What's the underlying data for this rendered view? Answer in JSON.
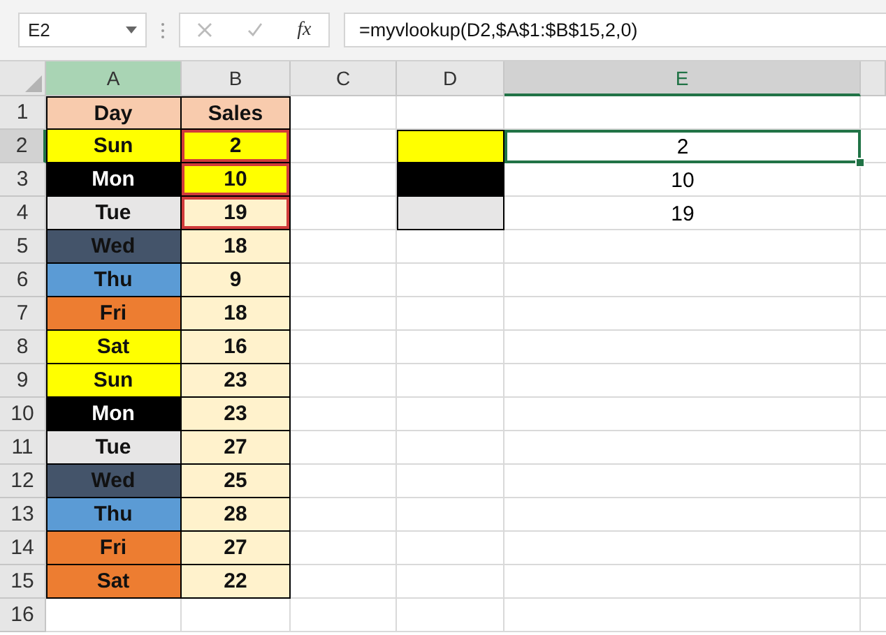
{
  "formula_bar": {
    "name_box": "E2",
    "function_label": "fx",
    "formula": "=myvlookup(D2,$A$1:$B$15,2,0)"
  },
  "columns": [
    {
      "label": "A",
      "selected": false,
      "highlighted": true
    },
    {
      "label": "B",
      "selected": false,
      "highlighted": false
    },
    {
      "label": "C",
      "selected": false,
      "highlighted": false
    },
    {
      "label": "D",
      "selected": false,
      "highlighted": false
    },
    {
      "label": "E",
      "selected": true,
      "highlighted": false
    }
  ],
  "rows": [
    {
      "number": "1",
      "selected": false,
      "a": {
        "text": "Day",
        "color": "#f8cbad"
      },
      "b": {
        "text": "Sales",
        "color": "#f8cbad",
        "outlined": false
      }
    },
    {
      "number": "2",
      "selected": true,
      "a": {
        "text": "Sun",
        "color": "#ffff00"
      },
      "b": {
        "text": "2",
        "color": "#ffff00",
        "outlined": true
      },
      "d": {
        "color": "#ffff00"
      },
      "e": {
        "text": "2",
        "selected": true
      }
    },
    {
      "number": "3",
      "selected": false,
      "a": {
        "text": "Mon",
        "color": "#000000"
      },
      "b": {
        "text": "10",
        "color": "#ffff00",
        "outlined": true
      },
      "d": {
        "color": "#000000"
      },
      "e": {
        "text": "10",
        "selected": false
      }
    },
    {
      "number": "4",
      "selected": false,
      "a": {
        "text": "Tue",
        "color": "#e7e6e6"
      },
      "b": {
        "text": "19",
        "color": "#fff2cc",
        "outlined": true
      },
      "d": {
        "color": "#e7e6e6"
      },
      "e": {
        "text": "19",
        "selected": false
      }
    },
    {
      "number": "5",
      "selected": false,
      "a": {
        "text": "Wed",
        "color": "#44546a"
      },
      "b": {
        "text": "18",
        "color": "#fff2cc",
        "outlined": false
      }
    },
    {
      "number": "6",
      "selected": false,
      "a": {
        "text": "Thu",
        "color": "#5b9bd5"
      },
      "b": {
        "text": "9",
        "color": "#fff2cc",
        "outlined": false
      }
    },
    {
      "number": "7",
      "selected": false,
      "a": {
        "text": "Fri",
        "color": "#ed7d31"
      },
      "b": {
        "text": "18",
        "color": "#fff2cc",
        "outlined": false
      }
    },
    {
      "number": "8",
      "selected": false,
      "a": {
        "text": "Sat",
        "color": "#ffff00"
      },
      "b": {
        "text": "16",
        "color": "#fff2cc",
        "outlined": false
      }
    },
    {
      "number": "9",
      "selected": false,
      "a": {
        "text": "Sun",
        "color": "#ffff00"
      },
      "b": {
        "text": "23",
        "color": "#fff2cc",
        "outlined": false
      }
    },
    {
      "number": "10",
      "selected": false,
      "a": {
        "text": "Mon",
        "color": "#000000"
      },
      "b": {
        "text": "23",
        "color": "#fff2cc",
        "outlined": false
      }
    },
    {
      "number": "11",
      "selected": false,
      "a": {
        "text": "Tue",
        "color": "#e7e6e6"
      },
      "b": {
        "text": "27",
        "color": "#fff2cc",
        "outlined": false
      }
    },
    {
      "number": "12",
      "selected": false,
      "a": {
        "text": "Wed",
        "color": "#44546a"
      },
      "b": {
        "text": "25",
        "color": "#fff2cc",
        "outlined": false
      }
    },
    {
      "number": "13",
      "selected": false,
      "a": {
        "text": "Thu",
        "color": "#5b9bd5"
      },
      "b": {
        "text": "28",
        "color": "#fff2cc",
        "outlined": false
      }
    },
    {
      "number": "14",
      "selected": false,
      "a": {
        "text": "Fri",
        "color": "#ed7d31"
      },
      "b": {
        "text": "27",
        "color": "#fff2cc",
        "outlined": false
      }
    },
    {
      "number": "15",
      "selected": false,
      "a": {
        "text": "Sat",
        "color": "#ed7d31"
      },
      "b": {
        "text": "22",
        "color": "#fff2cc",
        "outlined": false
      }
    },
    {
      "number": "16",
      "selected": false
    }
  ]
}
